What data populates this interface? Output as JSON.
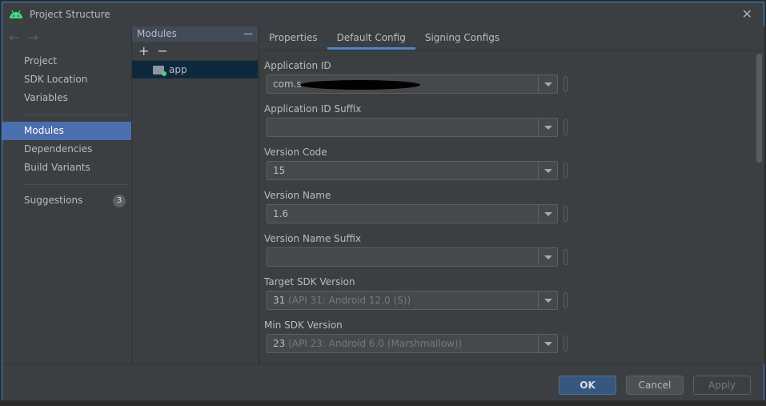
{
  "window": {
    "title": "Project Structure",
    "close": "✕"
  },
  "sidebar": {
    "back": "←",
    "forward": "→",
    "items": [
      {
        "label": "Project"
      },
      {
        "label": "SDK Location"
      },
      {
        "label": "Variables"
      },
      {
        "label": "Modules",
        "selected": true
      },
      {
        "label": "Dependencies"
      },
      {
        "label": "Build Variants"
      },
      {
        "label": "Suggestions",
        "badge": "3"
      }
    ]
  },
  "modules": {
    "title": "Modules",
    "collapse": "—",
    "add": "+",
    "remove": "−",
    "items": [
      {
        "label": "app"
      }
    ]
  },
  "tabs": [
    {
      "label": "Properties"
    },
    {
      "label": "Default Config",
      "active": true
    },
    {
      "label": "Signing Configs"
    }
  ],
  "form": {
    "fields": [
      {
        "label": "Application ID",
        "value": "com.s",
        "redacted": true
      },
      {
        "label": "Application ID Suffix",
        "value": ""
      },
      {
        "label": "Version Code",
        "value": "15"
      },
      {
        "label": "Version Name",
        "value": "1.6"
      },
      {
        "label": "Version Name Suffix",
        "value": ""
      },
      {
        "label": "Target SDK Version",
        "value": "31",
        "hint": "(API 31: Android 12.0 (S))"
      },
      {
        "label": "Min SDK Version",
        "value": "23",
        "hint": "(API 23: Android 6.0 (Marshmallow))"
      }
    ]
  },
  "footer": {
    "ok": "OK",
    "cancel": "Cancel",
    "apply": "Apply"
  },
  "colors": {
    "accent": "#4b6eaf",
    "border": "#3d8bd6",
    "ok": "#365880"
  }
}
